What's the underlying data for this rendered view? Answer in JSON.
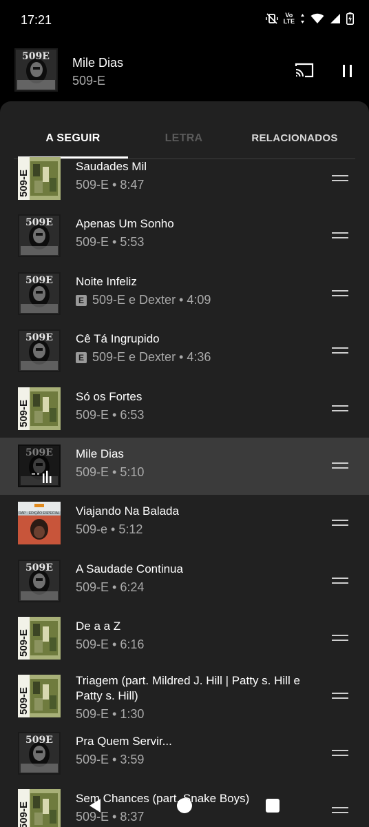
{
  "status_bar": {
    "time": "17:21",
    "network_label_top": "Vo",
    "network_label_bottom": "LTE",
    "icons": [
      "mute-vibrate-icon",
      "volte-icon",
      "data-arrows-icon",
      "wifi-icon",
      "signal-icon",
      "battery-charging-icon"
    ]
  },
  "mini_player": {
    "title": "Mile Dias",
    "artist": "509-E",
    "icons": [
      "cast-icon",
      "pause-icon"
    ]
  },
  "tabs": [
    {
      "label": "A SEGUIR",
      "selected": true
    },
    {
      "label": "LETRA",
      "selected": false,
      "disabled": true
    },
    {
      "label": "RELACIONADOS",
      "selected": false
    }
  ],
  "queue": [
    {
      "title": "Saudades Mil",
      "subtitle": "509-E • 8:47",
      "explicit": false,
      "art": "green-509e",
      "active": false
    },
    {
      "title": "Apenas Um Sonho",
      "subtitle": "509-E • 5:53",
      "explicit": false,
      "art": "dark-509e",
      "active": false
    },
    {
      "title": "Noite Infeliz",
      "subtitle": "509-E e Dexter • 4:09",
      "explicit": true,
      "art": "dark-509e",
      "active": false
    },
    {
      "title": "Cê Tá Ingrupido",
      "subtitle": "509-E e Dexter • 4:36",
      "explicit": true,
      "art": "dark-509e",
      "active": false
    },
    {
      "title": "Só os Fortes",
      "subtitle": "509-E • 6:53",
      "explicit": false,
      "art": "green-509e",
      "active": false
    },
    {
      "title": "Mile Dias",
      "subtitle": "509-E • 5:10",
      "explicit": false,
      "art": "dark-509e",
      "active": true
    },
    {
      "title": "Viajando Na Balada",
      "subtitle": "509-e • 5:12",
      "explicit": false,
      "art": "rap-edicao-especial",
      "active": false
    },
    {
      "title": "A Saudade Continua",
      "subtitle": "509-E • 6:24",
      "explicit": false,
      "art": "dark-509e",
      "active": false
    },
    {
      "title": "De a a Z",
      "subtitle": "509-E • 6:16",
      "explicit": false,
      "art": "green-509e",
      "active": false
    },
    {
      "title": "Triagem (part. Mildred J. Hill | Patty s. Hill e Patty s. Hill)",
      "subtitle": "509-E • 1:30",
      "explicit": false,
      "art": "green-509e",
      "active": false
    },
    {
      "title": "Pra Quem Servir...",
      "subtitle": "509-E • 3:59",
      "explicit": false,
      "art": "dark-509e",
      "active": false
    },
    {
      "title": "Sem Chances (part. Snake Boys)",
      "subtitle": "509-E • 8:37",
      "explicit": false,
      "art": "green-509e",
      "active": false
    }
  ],
  "art_label": "509-E",
  "rap_label": "RAP · EDIÇÃO ESPECIAL",
  "explicit_badge": "E",
  "colors": {
    "background": "#000000",
    "sheet": "#212121",
    "active_row": "#3b3b3b",
    "secondary_text": "#aaaaaa",
    "tab_disabled": "#5a5a5a"
  },
  "nav_icons": [
    "back-icon",
    "home-icon",
    "recents-icon"
  ]
}
